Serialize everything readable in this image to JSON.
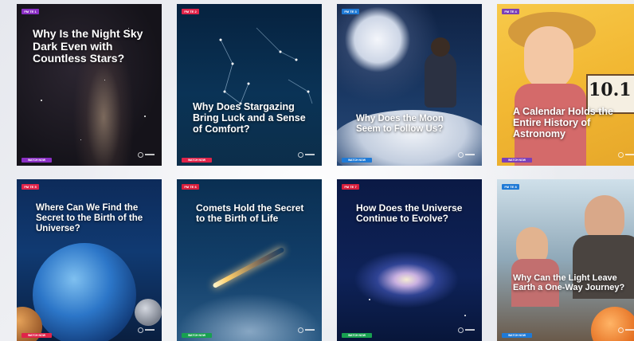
{
  "cards": [
    {
      "title": "Why Is the Night Sky Dark Even with Countless Stars?",
      "tag": "FM TE 1",
      "tag_color": "#8a2fc4",
      "cta": "WATCH NOW",
      "cta_color": "#8a2fc4"
    },
    {
      "title": "Why Does Stargazing Bring Luck and a Sense of Comfort?",
      "tag": "FM TE 2",
      "tag_color": "#e0244a",
      "cta": "WATCH NOW",
      "cta_color": "#e0244a"
    },
    {
      "title": "Why Does the Moon Seem to Follow Us?",
      "tag": "FM TE 3",
      "tag_color": "#1f7ad6",
      "cta": "WATCH NOW",
      "cta_color": "#1f7ad6"
    },
    {
      "title": "A Calendar Holds the Entire History of Astronomy",
      "tag": "FM TE 4",
      "tag_color": "#7b3fb8",
      "cta": "WATCH NOW",
      "cta_color": "#7b3fb8",
      "calendar_digits": "10.1"
    },
    {
      "title": "Where Can We Find the Secret to the Birth of the Universe?",
      "tag": "FM TE 5",
      "tag_color": "#e0244a",
      "cta": "WATCH NOW",
      "cta_color": "#e0244a"
    },
    {
      "title": "Comets Hold the Secret to the Birth of Life",
      "tag": "FM TE 6",
      "tag_color": "#d81e3c",
      "cta": "WATCH NOW",
      "cta_color": "#18a050"
    },
    {
      "title": "How Does the Universe Continue to Evolve?",
      "tag": "FM TE 7",
      "tag_color": "#d81e3c",
      "cta": "WATCH NOW",
      "cta_color": "#18a050"
    },
    {
      "title": "Why Can the Light Leave Earth a One-Way Journey?",
      "tag": "FM TE 8",
      "tag_color": "#1f7ad6",
      "cta": "WATCH NOW",
      "cta_color": "#1f7ad6"
    }
  ]
}
